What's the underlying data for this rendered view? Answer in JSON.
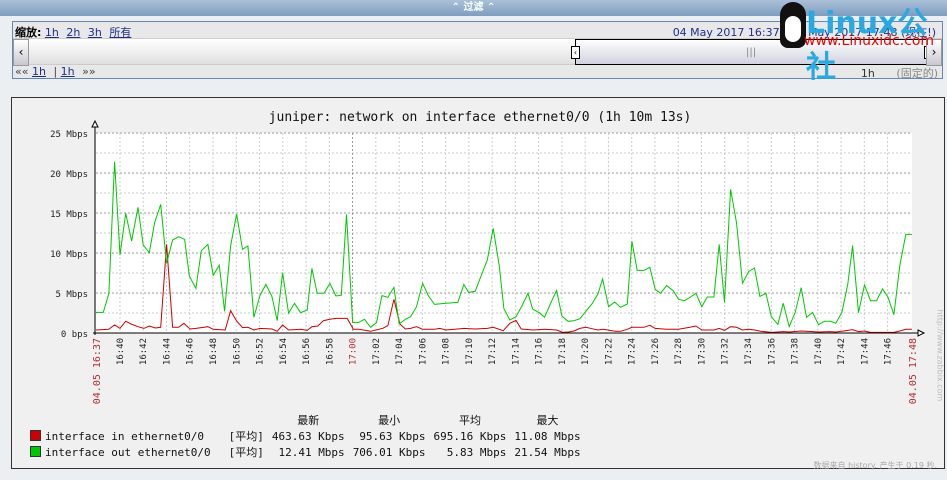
{
  "filter_bar": {
    "label": "过滤"
  },
  "time_filter": {
    "zoom_label": "缩放:",
    "zoom_options": [
      "1h",
      "2h",
      "3h",
      "所有"
    ],
    "range_text": "04 May 2017 16:37 - 04 May 2017 17:48",
    "now_label": "(现在!)",
    "nav_back": "««",
    "nav_back_period": "1h",
    "nav_sep": "|",
    "nav_forward_period": "1h",
    "nav_forward": "»»",
    "period": "1h",
    "fixed_label": "(固定的)"
  },
  "watermark": {
    "brand": "Linux公社",
    "url": "www.Linuxidc.com"
  },
  "colors": {
    "in": "#cc0000",
    "out": "#00c800",
    "grid": "#b0b0b0",
    "plot_bg": "#ffffff"
  },
  "chart_data": {
    "type": "line",
    "title": "juniper: network on interface ethernet0/0 (1h 10m 13s)",
    "x_unit": "minutes after 16:00",
    "xlim": [
      37.94,
      108.1
    ],
    "ylim": [
      0,
      25
    ],
    "y_unit": "Mbps",
    "y_ticks": [
      {
        "v": 0,
        "label": "0 bps"
      },
      {
        "v": 5,
        "label": "5 Mbps"
      },
      {
        "v": 10,
        "label": "10 Mbps"
      },
      {
        "v": 15,
        "label": "15 Mbps"
      },
      {
        "v": 20,
        "label": "20 Mbps"
      },
      {
        "v": 25,
        "label": "25 Mbps"
      }
    ],
    "x_ticks": [
      {
        "t": 40,
        "label": "16:40"
      },
      {
        "t": 42,
        "label": "16:42"
      },
      {
        "t": 44,
        "label": "16:44"
      },
      {
        "t": 46,
        "label": "16:46"
      },
      {
        "t": 48,
        "label": "16:48"
      },
      {
        "t": 50,
        "label": "16:50"
      },
      {
        "t": 52,
        "label": "16:52"
      },
      {
        "t": 54,
        "label": "16:54"
      },
      {
        "t": 56,
        "label": "16:56"
      },
      {
        "t": 58,
        "label": "16:58"
      },
      {
        "t": 60,
        "label": "17:00",
        "major": true
      },
      {
        "t": 62,
        "label": "17:02"
      },
      {
        "t": 64,
        "label": "17:04"
      },
      {
        "t": 66,
        "label": "17:06"
      },
      {
        "t": 68,
        "label": "17:08"
      },
      {
        "t": 70,
        "label": "17:10"
      },
      {
        "t": 72,
        "label": "17:12"
      },
      {
        "t": 74,
        "label": "17:14"
      },
      {
        "t": 76,
        "label": "17:16"
      },
      {
        "t": 78,
        "label": "17:18"
      },
      {
        "t": 80,
        "label": "17:20"
      },
      {
        "t": 82,
        "label": "17:22"
      },
      {
        "t": 84,
        "label": "17:24"
      },
      {
        "t": 86,
        "label": "17:26"
      },
      {
        "t": 88,
        "label": "17:28"
      },
      {
        "t": 90,
        "label": "17:30"
      },
      {
        "t": 92,
        "label": "17:32"
      },
      {
        "t": 94,
        "label": "17:34"
      },
      {
        "t": 96,
        "label": "17:36"
      },
      {
        "t": 98,
        "label": "17:38"
      },
      {
        "t": 100,
        "label": "17:40"
      },
      {
        "t": 102,
        "label": "17:42"
      },
      {
        "t": 104,
        "label": "17:44"
      },
      {
        "t": 106,
        "label": "17:46"
      }
    ],
    "x_edge_labels": [
      {
        "t": 37.94,
        "label": "04.05 16:37"
      },
      {
        "t": 108.1,
        "label": "04.05 17:48"
      }
    ],
    "series": [
      {
        "name": "interface in ethernet0/0",
        "color": "#cc0000",
        "points": [
          [
            37.94,
            0.38
          ],
          [
            39.03,
            0.46
          ],
          [
            39.54,
            1.0
          ],
          [
            40.0,
            0.58
          ],
          [
            40.49,
            1.46
          ],
          [
            41.03,
            1.08
          ],
          [
            41.55,
            0.79
          ],
          [
            42.06,
            0.58
          ],
          [
            42.52,
            0.88
          ],
          [
            43.04,
            0.63
          ],
          [
            43.5,
            0.71
          ],
          [
            44.01,
            11.08
          ],
          [
            44.53,
            0.71
          ],
          [
            45.04,
            0.71
          ],
          [
            45.5,
            1.21
          ],
          [
            46.02,
            0.5
          ],
          [
            46.53,
            0.58
          ],
          [
            47.56,
            0.79
          ],
          [
            48.02,
            0.46
          ],
          [
            49.05,
            0.38
          ],
          [
            49.51,
            2.79
          ],
          [
            50.03,
            1.5
          ],
          [
            50.54,
            0.67
          ],
          [
            51.0,
            0.71
          ],
          [
            51.52,
            0.38
          ],
          [
            52.03,
            0.58
          ],
          [
            53.07,
            0.5
          ],
          [
            53.52,
            0.21
          ],
          [
            53.98,
            1.0
          ],
          [
            54.5,
            0.38
          ],
          [
            55.53,
            0.46
          ],
          [
            56.1,
            0.33
          ],
          [
            56.5,
            0.79
          ],
          [
            57.02,
            0.88
          ],
          [
            57.48,
            1.54
          ],
          [
            58.05,
            1.71
          ],
          [
            58.57,
            1.83
          ],
          [
            59.54,
            1.83
          ],
          [
            60.06,
            0.46
          ],
          [
            60.52,
            0.46
          ],
          [
            61.55,
            0.21
          ],
          [
            62.58,
            0.58
          ],
          [
            63.04,
            0.92
          ],
          [
            63.55,
            4.21
          ],
          [
            64.07,
            1.13
          ],
          [
            64.53,
            0.5
          ],
          [
            64.99,
            0.58
          ],
          [
            65.5,
            0.79
          ],
          [
            66.02,
            0.46
          ],
          [
            67.05,
            0.46
          ],
          [
            67.51,
            0.58
          ],
          [
            68.02,
            0.38
          ],
          [
            69.05,
            0.5
          ],
          [
            69.57,
            0.58
          ],
          [
            70.54,
            0.5
          ],
          [
            71.58,
            0.58
          ],
          [
            72.09,
            0.71
          ],
          [
            72.95,
            0.29
          ],
          [
            73.53,
            1.21
          ],
          [
            74.05,
            1.58
          ],
          [
            74.5,
            0.5
          ],
          [
            75.54,
            0.38
          ],
          [
            76.51,
            0.46
          ],
          [
            77.54,
            0.38
          ],
          [
            78.06,
            0.08
          ],
          [
            78.57,
            0.13
          ],
          [
            79.03,
            0.25
          ],
          [
            79.55,
            0.58
          ],
          [
            80.06,
            0.71
          ],
          [
            80.58,
            0.54
          ],
          [
            81.09,
            0.38
          ],
          [
            81.55,
            0.46
          ],
          [
            82.58,
            0.21
          ],
          [
            83.04,
            0.21
          ],
          [
            83.62,
            0.46
          ],
          [
            84.02,
            0.71
          ],
          [
            85.05,
            0.71
          ],
          [
            85.56,
            0.96
          ],
          [
            86.02,
            0.58
          ],
          [
            87.0,
            0.46
          ],
          [
            88.03,
            0.46
          ],
          [
            89.0,
            0.71
          ],
          [
            89.52,
            0.88
          ],
          [
            90.03,
            0.38
          ],
          [
            91.07,
            0.38
          ],
          [
            91.52,
            0.58
          ],
          [
            91.98,
            0.33
          ],
          [
            92.5,
            0.79
          ],
          [
            93.01,
            0.71
          ],
          [
            93.53,
            0.38
          ],
          [
            94.05,
            0.46
          ],
          [
            94.56,
            0.38
          ],
          [
            95.08,
            0.21
          ],
          [
            96.05,
            0.08
          ],
          [
            97.03,
            0.17
          ],
          [
            97.54,
            0.13
          ],
          [
            98.57,
            0.25
          ],
          [
            99.55,
            0.17
          ],
          [
            100.06,
            0.13
          ],
          [
            101.04,
            0.17
          ],
          [
            101.55,
            0.13
          ],
          [
            102.07,
            0.21
          ],
          [
            102.99,
            0.42
          ],
          [
            103.5,
            0.17
          ],
          [
            104.02,
            0.25
          ],
          [
            104.53,
            0.08
          ],
          [
            106.54,
            0.08
          ],
          [
            107.05,
            0.25
          ],
          [
            107.57,
            0.46
          ],
          [
            108.09,
            0.46
          ]
        ]
      },
      {
        "name": "interface out ethernet0/0",
        "color": "#00c800",
        "points": [
          [
            37.94,
            2.58
          ],
          [
            38.57,
            2.58
          ],
          [
            39.05,
            4.96
          ],
          [
            39.54,
            21.4
          ],
          [
            40.0,
            9.75
          ],
          [
            40.49,
            14.96
          ],
          [
            41.0,
            11.5
          ],
          [
            41.55,
            15.71
          ],
          [
            42.0,
            11.0
          ],
          [
            42.52,
            10.04
          ],
          [
            42.98,
            13.79
          ],
          [
            43.5,
            16.08
          ],
          [
            44.01,
            8.71
          ],
          [
            44.53,
            11.63
          ],
          [
            45.04,
            12.04
          ],
          [
            45.56,
            11.71
          ],
          [
            45.96,
            7.13
          ],
          [
            46.53,
            5.58
          ],
          [
            46.99,
            10.29
          ],
          [
            47.56,
            11.08
          ],
          [
            48.02,
            7.21
          ],
          [
            48.54,
            8.46
          ],
          [
            49.0,
            2.71
          ],
          [
            49.51,
            10.88
          ],
          [
            50.03,
            14.88
          ],
          [
            50.54,
            10.46
          ],
          [
            51.0,
            10.88
          ],
          [
            51.52,
            1.96
          ],
          [
            52.03,
            4.67
          ],
          [
            52.55,
            6.08
          ],
          [
            53.07,
            4.54
          ],
          [
            53.52,
            1.54
          ],
          [
            53.98,
            7.54
          ],
          [
            54.5,
            2.46
          ],
          [
            55.01,
            3.71
          ],
          [
            55.53,
            2.54
          ],
          [
            56.1,
            2.88
          ],
          [
            56.5,
            8.08
          ],
          [
            56.96,
            4.96
          ],
          [
            57.54,
            4.96
          ],
          [
            58.05,
            6.21
          ],
          [
            58.57,
            4.63
          ],
          [
            59.03,
            4.71
          ],
          [
            59.48,
            14.83
          ],
          [
            60.0,
            1.33
          ],
          [
            60.52,
            1.33
          ],
          [
            61.03,
            1.71
          ],
          [
            61.55,
            0.71
          ],
          [
            62.06,
            1.29
          ],
          [
            62.52,
            4.67
          ],
          [
            63.04,
            4.46
          ],
          [
            63.55,
            5.71
          ],
          [
            64.01,
            1.13
          ],
          [
            64.53,
            1.71
          ],
          [
            64.99,
            2.04
          ],
          [
            65.5,
            3.29
          ],
          [
            66.02,
            6.21
          ],
          [
            66.53,
            4.63
          ],
          [
            67.05,
            3.58
          ],
          [
            68.02,
            3.71
          ],
          [
            69.05,
            3.83
          ],
          [
            69.57,
            6.08
          ],
          [
            69.97,
            5.08
          ],
          [
            70.54,
            5.21
          ],
          [
            71.06,
            7.17
          ],
          [
            71.58,
            9.13
          ],
          [
            72.09,
            13.08
          ],
          [
            72.61,
            8.46
          ],
          [
            73.01,
            3.04
          ],
          [
            73.52,
            1.63
          ],
          [
            74.05,
            2.04
          ],
          [
            74.56,
            3.38
          ],
          [
            75.08,
            4.96
          ],
          [
            75.48,
            3.0
          ],
          [
            76.05,
            2.54
          ],
          [
            76.51,
            1.96
          ],
          [
            77.03,
            3.71
          ],
          [
            77.54,
            5.33
          ],
          [
            78.0,
            2.13
          ],
          [
            78.52,
            1.46
          ],
          [
            79.03,
            1.54
          ],
          [
            79.55,
            1.79
          ],
          [
            80.06,
            2.71
          ],
          [
            80.58,
            3.63
          ],
          [
            81.09,
            4.88
          ],
          [
            81.5,
            6.75
          ],
          [
            82.01,
            3.29
          ],
          [
            82.53,
            3.88
          ],
          [
            83.04,
            3.21
          ],
          [
            83.62,
            3.63
          ],
          [
            84.02,
            11.46
          ],
          [
            84.47,
            7.83
          ],
          [
            85.05,
            7.83
          ],
          [
            85.56,
            8.21
          ],
          [
            86.02,
            5.46
          ],
          [
            86.48,
            4.96
          ],
          [
            87.0,
            5.92
          ],
          [
            87.57,
            5.29
          ],
          [
            88.03,
            4.21
          ],
          [
            88.54,
            4.04
          ],
          [
            89.06,
            4.5
          ],
          [
            89.52,
            4.96
          ],
          [
            90.03,
            3.29
          ],
          [
            90.49,
            4.5
          ],
          [
            91.07,
            4.5
          ],
          [
            91.52,
            11.08
          ],
          [
            91.98,
            3.83
          ],
          [
            92.5,
            17.96
          ],
          [
            93.01,
            13.79
          ],
          [
            93.53,
            6.21
          ],
          [
            94.05,
            7.67
          ],
          [
            94.56,
            8.13
          ],
          [
            95.02,
            4.58
          ],
          [
            95.54,
            4.96
          ],
          [
            96.0,
            2.04
          ],
          [
            96.57,
            1.08
          ],
          [
            97.03,
            3.71
          ],
          [
            97.54,
            0.79
          ],
          [
            98.06,
            2.58
          ],
          [
            98.57,
            5.67
          ],
          [
            99.03,
            1.96
          ],
          [
            99.55,
            2.58
          ],
          [
            100.06,
            1.04
          ],
          [
            100.58,
            1.46
          ],
          [
            101.09,
            1.46
          ],
          [
            101.55,
            1.21
          ],
          [
            102.07,
            2.58
          ],
          [
            102.58,
            6.13
          ],
          [
            102.99,
            10.92
          ],
          [
            103.5,
            2.54
          ],
          [
            104.02,
            6.0
          ],
          [
            104.53,
            4.04
          ],
          [
            105.05,
            4.04
          ],
          [
            105.56,
            5.5
          ],
          [
            106.02,
            4.54
          ],
          [
            106.54,
            2.29
          ],
          [
            107.05,
            8.42
          ],
          [
            107.57,
            12.33
          ],
          [
            108.09,
            12.33
          ]
        ]
      }
    ],
    "legend": {
      "headers": [
        "最新",
        "最小",
        "平均",
        "最大"
      ],
      "rows": [
        {
          "name": "interface in ethernet0/0",
          "func": "[平均]",
          "last": "463.63 Kbps",
          "min": "95.63 Kbps",
          "avg": "695.16 Kbps",
          "max": "11.08 Mbps"
        },
        {
          "name": "interface out ethernet0/0",
          "func": "[平均]",
          "last": "12.41 Mbps",
          "min": "706.01 Kbps",
          "avg": "5.83 Mbps",
          "max": "21.54 Mbps"
        }
      ]
    },
    "footer": "数据来自 history. 产生于 0.19 秒.",
    "side_text": "http://www.zabbix.com"
  }
}
